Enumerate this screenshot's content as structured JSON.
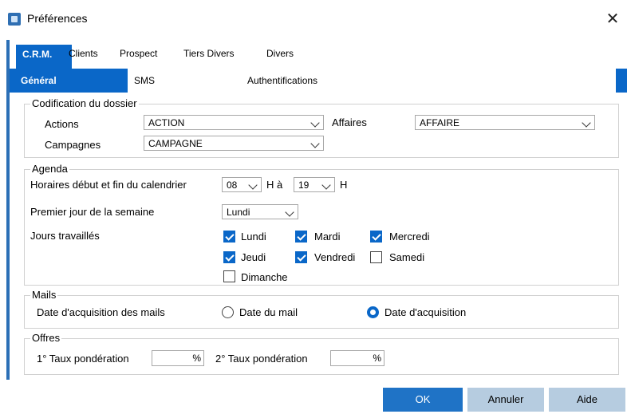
{
  "window": {
    "title": "Préférences",
    "close_glyph": "✕"
  },
  "top_tabs": [
    "C.R.M.",
    "Clients",
    "Prospect",
    "Tiers Divers",
    "Divers"
  ],
  "sub_tabs": [
    "Général",
    "SMS",
    "Authentifications"
  ],
  "codification": {
    "legend": "Codification du dossier",
    "actions_label": "Actions",
    "actions_value": "ACTION",
    "affaires_label": "Affaires",
    "affaires_value": "AFFAIRE",
    "campagnes_label": "Campagnes",
    "campagnes_value": "CAMPAGNE"
  },
  "agenda": {
    "legend": "Agenda",
    "hours_label": "Horaires début et fin du calendrier",
    "start_hour": "08",
    "h_a": "H à",
    "end_hour": "19",
    "h": "H",
    "first_day_label": "Premier jour de la semaine",
    "first_day_value": "Lundi",
    "workdays_label": "Jours travaillés",
    "days": [
      {
        "label": "Lundi",
        "checked": true
      },
      {
        "label": "Mardi",
        "checked": true
      },
      {
        "label": "Mercredi",
        "checked": true
      },
      {
        "label": "Jeudi",
        "checked": true
      },
      {
        "label": "Vendredi",
        "checked": true
      },
      {
        "label": "Samedi",
        "checked": false
      },
      {
        "label": "Dimanche",
        "checked": false
      }
    ]
  },
  "mails": {
    "legend": "Mails",
    "date_label": "Date d'acquisition des mails",
    "option_mail": "Date du mail",
    "option_acquisition": "Date d'acquisition",
    "selected": "Date d'acquisition"
  },
  "offres": {
    "legend": "Offres",
    "taux1_label": "1° Taux pondération",
    "taux1_unit": "%",
    "taux2_label": "2° Taux pondération",
    "taux2_unit": "%"
  },
  "buttons": {
    "ok": "OK",
    "cancel": "Annuler",
    "help": "Aide"
  },
  "colors": {
    "accent": "#0a67c8",
    "button_primary": "#1f73c6",
    "button_secondary": "#b6cce0"
  }
}
